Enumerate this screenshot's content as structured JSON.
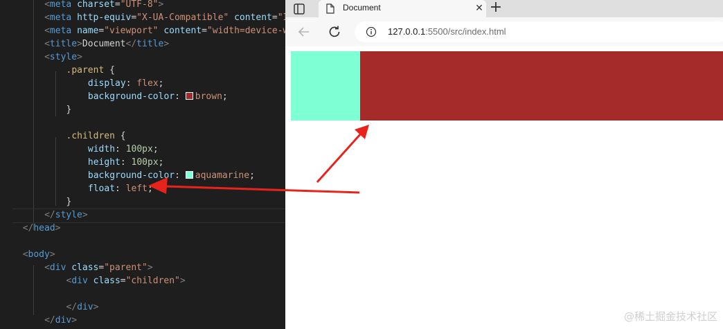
{
  "editor": {
    "indent_guides": [
      [
        48,
        0,
        332
      ],
      [
        80,
        103,
        65
      ],
      [
        80,
        198,
        99
      ],
      [
        48,
        383,
        72
      ]
    ],
    "current_line": 16,
    "lines": [
      {
        "indent": 3,
        "tokens": [
          [
            "punc",
            "<"
          ],
          [
            "tag",
            "meta"
          ],
          [
            "text",
            " "
          ],
          [
            "attr",
            "charset"
          ],
          [
            "text",
            "="
          ],
          [
            "str",
            "\"UTF-8\""
          ],
          [
            "punc",
            ">"
          ]
        ]
      },
      {
        "indent": 3,
        "tokens": [
          [
            "punc",
            "<"
          ],
          [
            "tag",
            "meta"
          ],
          [
            "text",
            " "
          ],
          [
            "attr",
            "http-equiv"
          ],
          [
            "text",
            "="
          ],
          [
            "str",
            "\"X-UA-Compatible\""
          ],
          [
            "text",
            " "
          ],
          [
            "attr",
            "content"
          ],
          [
            "text",
            "="
          ],
          [
            "str",
            "\"IE="
          ]
        ]
      },
      {
        "indent": 3,
        "tokens": [
          [
            "punc",
            "<"
          ],
          [
            "tag",
            "meta"
          ],
          [
            "text",
            " "
          ],
          [
            "attr",
            "name"
          ],
          [
            "text",
            "="
          ],
          [
            "str",
            "\"viewport\""
          ],
          [
            "text",
            " "
          ],
          [
            "attr",
            "content"
          ],
          [
            "text",
            "="
          ],
          [
            "str",
            "\"width=device-wid"
          ]
        ]
      },
      {
        "indent": 3,
        "tokens": [
          [
            "punc",
            "<"
          ],
          [
            "tag",
            "title"
          ],
          [
            "punc",
            ">"
          ],
          [
            "text",
            "Document"
          ],
          [
            "punc",
            "</"
          ],
          [
            "tag",
            "title"
          ],
          [
            "punc",
            ">"
          ]
        ]
      },
      {
        "indent": 3,
        "tokens": [
          [
            "punc",
            "<"
          ],
          [
            "tag",
            "style"
          ],
          [
            "punc",
            ">"
          ]
        ]
      },
      {
        "indent": 5,
        "tokens": [
          [
            "sel",
            ".parent"
          ],
          [
            "text",
            " {"
          ]
        ]
      },
      {
        "indent": 7,
        "tokens": [
          [
            "prop",
            "display"
          ],
          [
            "text",
            ": "
          ],
          [
            "val",
            "flex"
          ],
          [
            "text",
            ";"
          ]
        ]
      },
      {
        "indent": 7,
        "tokens": [
          [
            "prop",
            "background-color"
          ],
          [
            "text",
            ": "
          ],
          [
            "swatch",
            "#a52a2a"
          ],
          [
            "val",
            "brown"
          ],
          [
            "text",
            ";"
          ]
        ]
      },
      {
        "indent": 5,
        "tokens": [
          [
            "text",
            "}"
          ]
        ]
      },
      {
        "indent": 0,
        "tokens": []
      },
      {
        "indent": 5,
        "tokens": [
          [
            "sel",
            ".children"
          ],
          [
            "text",
            " {"
          ]
        ]
      },
      {
        "indent": 7,
        "tokens": [
          [
            "prop",
            "width"
          ],
          [
            "text",
            ": "
          ],
          [
            "num",
            "100px"
          ],
          [
            "text",
            ";"
          ]
        ]
      },
      {
        "indent": 7,
        "tokens": [
          [
            "prop",
            "height"
          ],
          [
            "text",
            ": "
          ],
          [
            "num",
            "100px"
          ],
          [
            "text",
            ";"
          ]
        ]
      },
      {
        "indent": 7,
        "tokens": [
          [
            "prop",
            "background-color"
          ],
          [
            "text",
            ": "
          ],
          [
            "swatch",
            "#7fffd4"
          ],
          [
            "val",
            "aquamarine"
          ],
          [
            "text",
            ";"
          ]
        ]
      },
      {
        "indent": 7,
        "tokens": [
          [
            "prop",
            "float"
          ],
          [
            "text",
            ": "
          ],
          [
            "val",
            "left"
          ],
          [
            "text",
            ";"
          ]
        ]
      },
      {
        "indent": 5,
        "tokens": [
          [
            "text",
            "}"
          ]
        ]
      },
      {
        "indent": 3,
        "tokens": [
          [
            "punc",
            "</"
          ],
          [
            "tag",
            "style"
          ],
          [
            "punc",
            ">"
          ]
        ]
      },
      {
        "indent": 1,
        "tokens": [
          [
            "punc",
            "</"
          ],
          [
            "tag",
            "head"
          ],
          [
            "punc",
            ">"
          ]
        ]
      },
      {
        "indent": 0,
        "tokens": []
      },
      {
        "indent": 1,
        "tokens": [
          [
            "punc",
            "<"
          ],
          [
            "tag",
            "body"
          ],
          [
            "punc",
            ">"
          ]
        ]
      },
      {
        "indent": 3,
        "tokens": [
          [
            "punc",
            "<"
          ],
          [
            "tag",
            "div"
          ],
          [
            "text",
            " "
          ],
          [
            "attr",
            "class"
          ],
          [
            "text",
            "="
          ],
          [
            "str",
            "\"parent\""
          ],
          [
            "punc",
            ">"
          ]
        ]
      },
      {
        "indent": 5,
        "tokens": [
          [
            "punc",
            "<"
          ],
          [
            "tag",
            "div"
          ],
          [
            "text",
            " "
          ],
          [
            "attr",
            "class"
          ],
          [
            "text",
            "="
          ],
          [
            "str",
            "\"children\""
          ],
          [
            "punc",
            ">"
          ]
        ]
      },
      {
        "indent": 0,
        "tokens": []
      },
      {
        "indent": 5,
        "tokens": [
          [
            "punc",
            "</"
          ],
          [
            "tag",
            "div"
          ],
          [
            "punc",
            ">"
          ]
        ]
      },
      {
        "indent": 3,
        "tokens": [
          [
            "punc",
            "</"
          ],
          [
            "tag",
            "div"
          ],
          [
            "punc",
            ">"
          ]
        ]
      }
    ]
  },
  "browser": {
    "tab": {
      "title": "Document",
      "close_label": "✕"
    },
    "new_tab_label": "+",
    "address": {
      "url_host": "127.0.0.1",
      "url_rest": ":5500/src/index.html"
    }
  },
  "page": {
    "parent_color": "#a52a2a",
    "child_color": "#7fffd4"
  },
  "annotations": {
    "arrow_color": "#e8231c"
  },
  "watermark": "@稀土掘金技术社区"
}
